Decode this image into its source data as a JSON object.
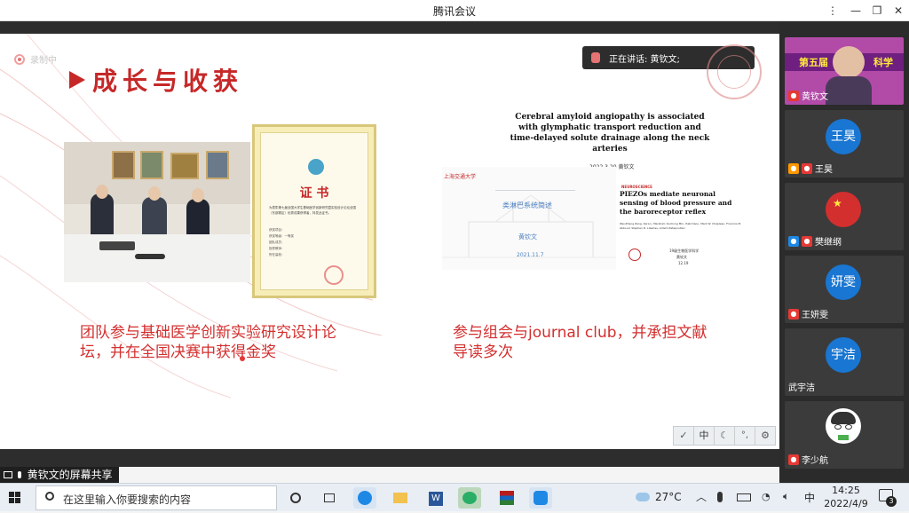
{
  "app": {
    "title": "腾讯会议"
  },
  "window_controls": {
    "more": "⋮",
    "minimize": "—",
    "restore": "❐",
    "close": "✕"
  },
  "recording": {
    "label": "录制中"
  },
  "speaking": {
    "label": "正在讲话: 黄钦文;"
  },
  "slide": {
    "heading": "成长与收获",
    "certificate": {
      "title": "证  书",
      "body": "为表彰第七届全国大学生基础医学创新研究暨实验设计论坛全国（东部赛区）优秀成果获得者，特发此证书。",
      "fields": [
        "获奖项目：",
        "获奖等级：一等奖",
        "团队成员：",
        "指导教师：",
        "所在高校："
      ]
    },
    "papers": {
      "title": "Cerebral amyloid angiopathy is associated with glymphatic transport reduction and time-delayed solute drainage along the neck arteries",
      "date_author": "2022.3.20 黄钦文",
      "lymph_title": "类淋巴系统简述",
      "lymph_author": "黄钦文",
      "lymph_date": "2021.11.7",
      "tag": "NEUROSCIENCE",
      "piezo_title": "PIEZOs mediate neuronal sensing of blood pressure and the baroreceptor reflex",
      "piezo_authors": "Wei-Zheng Zeng, Kara L. Marshall, Soohong Min, Ihab Daou, Mark W. Chapleau, Francois M. Abboud, Stephen D. Liberles, Ardem Patapoutian",
      "piezo_foot1": "19级生物医学科学",
      "piezo_foot2": "黄钦文",
      "piezo_foot3": "12.19"
    },
    "caption_left": "团队参与基础医学创新实验研究设计论坛，并在全国决赛中获得金奖",
    "caption_right": "参与组会与journal club，并承担文献导读多次"
  },
  "toolbar": [
    "✓",
    "中",
    "☾",
    "°,",
    "⚙"
  ],
  "screen_share": {
    "label": "黄钦文的屏幕共享"
  },
  "participants": [
    {
      "name": "黄钦文",
      "avatar": "",
      "type": "video"
    },
    {
      "name": "王昊",
      "avatar": "王昊",
      "type": "avatar"
    },
    {
      "name": "樊继纲",
      "avatar": "",
      "type": "flag"
    },
    {
      "name": "王妍雯",
      "avatar": "妍雯",
      "type": "avatar"
    },
    {
      "name": "武宇洁",
      "avatar": "宇洁",
      "type": "avatar"
    },
    {
      "name": "李少航",
      "avatar": "",
      "type": "cartoon"
    }
  ],
  "video_banner": "第五届",
  "video_banner2": "科学",
  "taskbar": {
    "search_placeholder": "在这里输入你要搜索的内容",
    "weather": "27°C",
    "ime": "中",
    "time": "14:25",
    "date": "2022/4/9",
    "notifications": "3"
  },
  "colors": {
    "accent": "#d32f2f",
    "avatar_blue": "#1976d2"
  }
}
